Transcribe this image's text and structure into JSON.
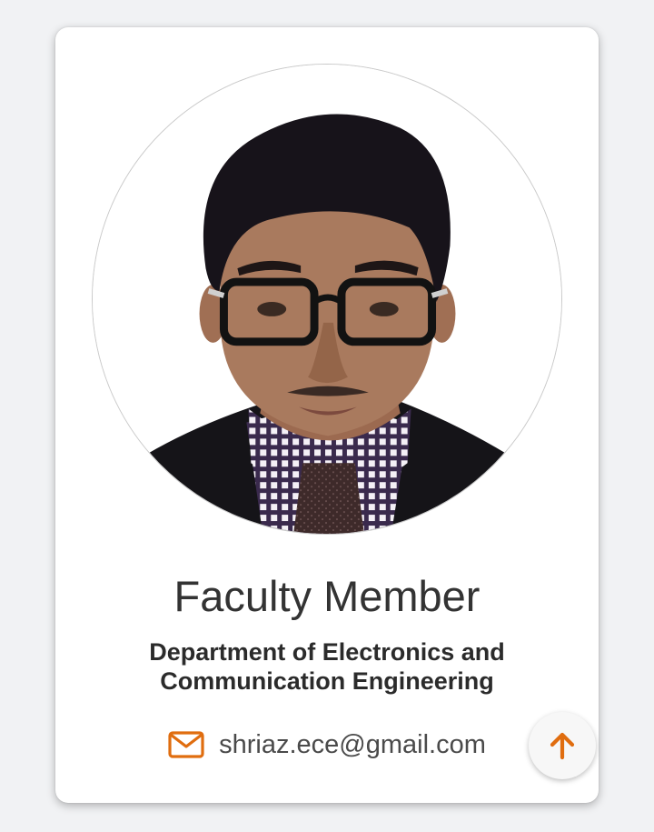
{
  "profile": {
    "title": "Faculty Member",
    "department": "Department of Electronics and Communication Engineering",
    "email": "shriaz.ece@gmail.com",
    "photo_icon": "profile-photo",
    "email_icon": "envelope-icon"
  },
  "scroll_top": {
    "icon": "arrow-up-icon"
  },
  "colors": {
    "accent": "#e06d0f",
    "card_background": "#ffffff",
    "page_background": "#f1f2f4",
    "title_text": "#333333"
  }
}
